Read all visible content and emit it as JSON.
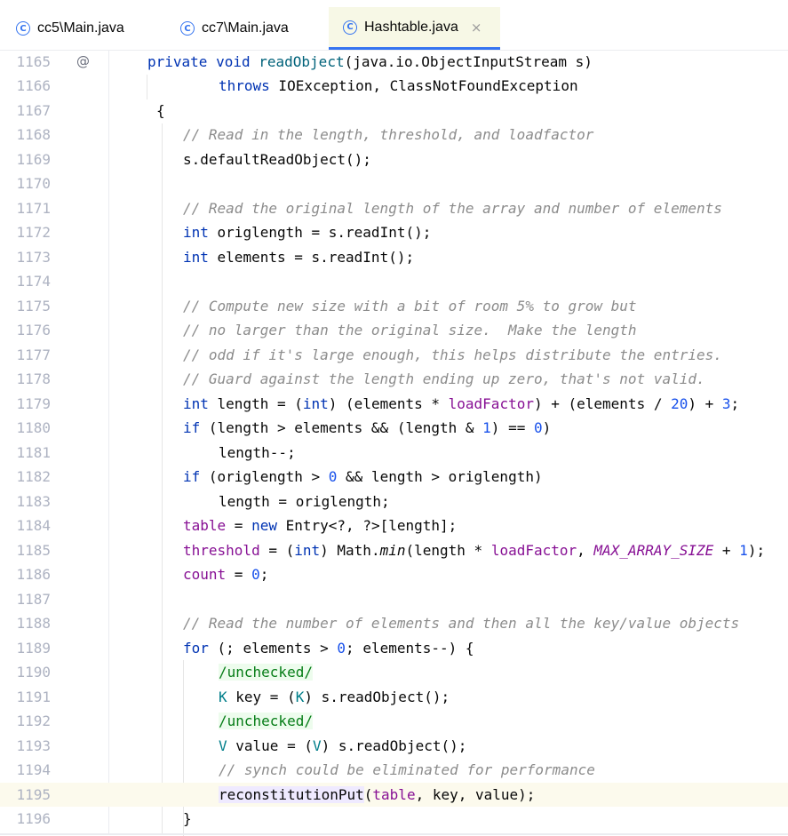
{
  "tabs": [
    {
      "label": "cc5\\Main.java",
      "active": false
    },
    {
      "label": "cc7\\Main.java",
      "active": false
    },
    {
      "label": "Hashtable.java",
      "active": true,
      "close": "×"
    }
  ],
  "editor": {
    "current_line": 1195,
    "override_marker": "@",
    "lines": [
      {
        "n": "1165",
        "indent": 0,
        "marker": true,
        "tokens": [
          [
            "kw",
            "private"
          ],
          [
            "",
            "  "
          ],
          [
            "kw",
            "void"
          ],
          [
            "",
            ""
          ],
          [
            "fn",
            "readObject"
          ],
          [
            "",
            "(java.io.ObjectInputStream s)"
          ]
        ]
      },
      {
        "n": "1166",
        "indent": 4,
        "tokens": [
          [
            "kw",
            "throws"
          ],
          [
            "",
            "IOException, ClassNotFoundException"
          ]
        ]
      },
      {
        "n": "1167",
        "indent": 0.5,
        "tokens": [
          [
            "",
            "{"
          ]
        ]
      },
      {
        "n": "1168",
        "indent": 2,
        "tokens": [
          [
            "cm",
            "// Read in the length, threshold, and loadfactor"
          ]
        ]
      },
      {
        "n": "1169",
        "indent": 2,
        "tokens": [
          [
            "",
            "s.defaultReadObject();"
          ]
        ]
      },
      {
        "n": "1170",
        "indent": 2,
        "tokens": []
      },
      {
        "n": "1171",
        "indent": 2,
        "tokens": [
          [
            "cm",
            "// Read the original length of the array and number of elements"
          ]
        ]
      },
      {
        "n": "1172",
        "indent": 2,
        "tokens": [
          [
            "kw",
            "int"
          ],
          [
            "",
            " origlength = s.readInt();"
          ]
        ]
      },
      {
        "n": "1173",
        "indent": 2,
        "tokens": [
          [
            "kw",
            "int"
          ],
          [
            "",
            " elements = s.readInt();"
          ]
        ]
      },
      {
        "n": "1174",
        "indent": 2,
        "tokens": []
      },
      {
        "n": "1175",
        "indent": 2,
        "tokens": [
          [
            "cm",
            "// Compute new size with a bit of room 5% to grow but"
          ]
        ]
      },
      {
        "n": "1176",
        "indent": 2,
        "tokens": [
          [
            "cm",
            "// no larger than the original size.  Make the length"
          ]
        ]
      },
      {
        "n": "1177",
        "indent": 2,
        "tokens": [
          [
            "cm",
            "// odd if it's large enough, this helps distribute the entries."
          ]
        ]
      },
      {
        "n": "1178",
        "indent": 2,
        "tokens": [
          [
            "cm",
            "// Guard against the length ending up zero, that's not valid."
          ]
        ]
      },
      {
        "n": "1179",
        "indent": 2,
        "tokens": [
          [
            "kw",
            "int"
          ],
          [
            "",
            " length = ("
          ],
          [
            "kw",
            "int"
          ],
          [
            "",
            ") (elements * "
          ],
          [
            "fld",
            "loadFactor"
          ],
          [
            "",
            ") + (elements / "
          ],
          [
            "num",
            "20"
          ],
          [
            "",
            ") + "
          ],
          [
            "num",
            "3"
          ],
          [
            "",
            ";"
          ]
        ]
      },
      {
        "n": "1180",
        "indent": 2,
        "tokens": [
          [
            "kw",
            "if"
          ],
          [
            "",
            " (length > elements && (length & "
          ],
          [
            "num",
            "1"
          ],
          [
            "",
            ") == "
          ],
          [
            "num",
            "0"
          ],
          [
            "",
            ")"
          ]
        ]
      },
      {
        "n": "1181",
        "indent": 4,
        "tokens": [
          [
            "",
            "length--;"
          ]
        ]
      },
      {
        "n": "1182",
        "indent": 2,
        "tokens": [
          [
            "kw",
            "if"
          ],
          [
            "",
            " (origlength > "
          ],
          [
            "num",
            "0"
          ],
          [
            "",
            " && length > origlength)"
          ]
        ]
      },
      {
        "n": "1183",
        "indent": 4,
        "tokens": [
          [
            "",
            "length = origlength;"
          ]
        ]
      },
      {
        "n": "1184",
        "indent": 2,
        "tokens": [
          [
            "fld",
            "table"
          ],
          [
            "",
            " = "
          ],
          [
            "kw",
            "new"
          ],
          [
            "",
            " Entry<?, ?>[length];"
          ]
        ]
      },
      {
        "n": "1185",
        "indent": 2,
        "tokens": [
          [
            "fld",
            "threshold"
          ],
          [
            "",
            " = ("
          ],
          [
            "kw",
            "int"
          ],
          [
            "",
            ") Math."
          ],
          [
            "it",
            "min"
          ],
          [
            "",
            "(length * "
          ],
          [
            "fld",
            "loadFactor"
          ],
          [
            "",
            ", "
          ],
          [
            "cst",
            "MAX_ARRAY_SIZE"
          ],
          [
            "",
            " + "
          ],
          [
            "num",
            "1"
          ],
          [
            "",
            ");"
          ]
        ]
      },
      {
        "n": "1186",
        "indent": 2,
        "tokens": [
          [
            "fld",
            "count"
          ],
          [
            "",
            " = "
          ],
          [
            "num",
            "0"
          ],
          [
            "",
            ";"
          ]
        ]
      },
      {
        "n": "1187",
        "indent": 2,
        "tokens": []
      },
      {
        "n": "1188",
        "indent": 2,
        "tokens": [
          [
            "cm",
            "// Read the number of elements and then all the key/value objects"
          ]
        ]
      },
      {
        "n": "1189",
        "indent": 2,
        "tokens": [
          [
            "kw",
            "for"
          ],
          [
            "",
            " (; elements > "
          ],
          [
            "num",
            "0"
          ],
          [
            "",
            "; elements--) {"
          ]
        ]
      },
      {
        "n": "1190",
        "indent": 4,
        "tokens": [
          [
            "hl-green",
            "/unchecked/"
          ]
        ]
      },
      {
        "n": "1191",
        "indent": 4,
        "tokens": [
          [
            "tp",
            "K"
          ],
          [
            "",
            " key = ("
          ],
          [
            "tp",
            "K"
          ],
          [
            "",
            ") s.readObject();"
          ]
        ]
      },
      {
        "n": "1192",
        "indent": 4,
        "tokens": [
          [
            "hl-green",
            "/unchecked/"
          ]
        ]
      },
      {
        "n": "1193",
        "indent": 4,
        "tokens": [
          [
            "tp",
            "V"
          ],
          [
            "",
            " value = ("
          ],
          [
            "tp",
            "V"
          ],
          [
            "",
            ") s.readObject();"
          ]
        ]
      },
      {
        "n": "1194",
        "indent": 4,
        "tokens": [
          [
            "cm",
            "// synch could be eliminated for performance"
          ]
        ]
      },
      {
        "n": "1195",
        "indent": 4,
        "tokens": [
          [
            "hl-purple",
            "reconstitutionPut"
          ],
          [
            "",
            "("
          ],
          [
            "fld",
            "table"
          ],
          [
            "",
            ", key, value);"
          ]
        ]
      },
      {
        "n": "1196",
        "indent": 2,
        "tokens": [
          [
            "",
            "}"
          ]
        ]
      }
    ]
  }
}
